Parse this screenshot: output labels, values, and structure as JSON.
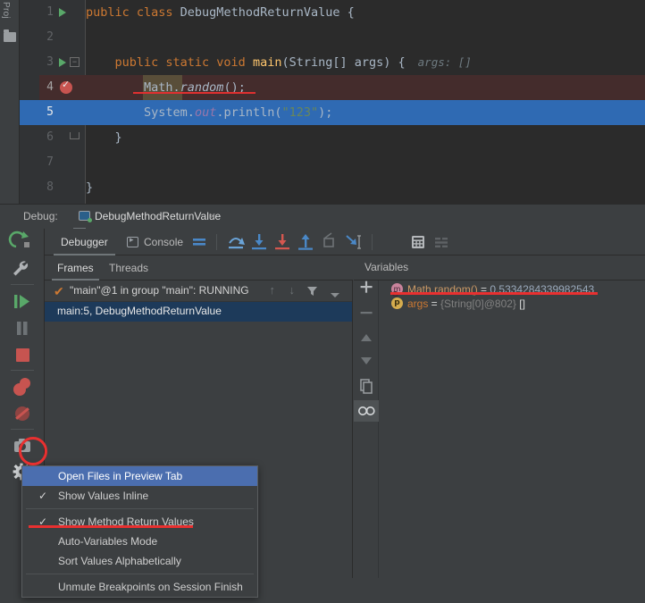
{
  "toolwindow": {
    "project_label": "Proj",
    "folder_icon": "folder-icon"
  },
  "editor": {
    "lines": [
      {
        "number": "1",
        "text": "public class DebugMethodReturnValue {"
      },
      {
        "number": "2",
        "text": ""
      },
      {
        "number": "3",
        "text": "    public static void main(String[] args) {"
      },
      {
        "number": "4",
        "text": "        Math.random();"
      },
      {
        "number": "5",
        "text": "        System.out.println(\"123\");"
      },
      {
        "number": "6",
        "text": "    }"
      },
      {
        "number": "7",
        "text": ""
      },
      {
        "number": "8",
        "text": "}"
      }
    ],
    "tokens": {
      "l1_kw": "public class ",
      "l1_cls": "DebugMethodReturnValue",
      "l1_brace": " {",
      "l3_kw1": "public static void ",
      "l3_mth": "main",
      "l3_rest": "(String[] args) {",
      "l3_hint": "args: []",
      "l4_a": "Math.",
      "l4_b": "random",
      "l4_c": "();",
      "l5_a": "System.",
      "l5_out": "out",
      "l5_b": ".println(",
      "l5_str": "\"123\"",
      "l5_c": ");",
      "l6": "}",
      "l8": "}"
    }
  },
  "debug_header": {
    "label": "Debug:",
    "tab_title": "DebugMethodReturnValue",
    "close_glyph": "×"
  },
  "side_toolbar": {
    "items": [
      {
        "name": "rerun-icon",
        "title": "Rerun"
      },
      {
        "name": "settings-wrench-icon",
        "title": "Settings"
      },
      {
        "name": "resume-program-icon",
        "title": "Resume Program"
      },
      {
        "name": "pause-program-icon",
        "title": "Pause Program"
      },
      {
        "name": "stop-icon",
        "title": "Stop"
      },
      {
        "name": "view-breakpoints-icon",
        "title": "View Breakpoints"
      },
      {
        "name": "mute-breakpoints-icon",
        "title": "Mute Breakpoints"
      },
      {
        "name": "camera-icon",
        "title": "Get Thread Dump"
      },
      {
        "name": "gear-settings-icon",
        "title": "Settings"
      }
    ]
  },
  "debug_toolbar": {
    "tab_debugger": "Debugger",
    "tab_console": "Console",
    "icons": [
      {
        "name": "show-execution-point-icon"
      },
      {
        "name": "step-over-icon"
      },
      {
        "name": "step-into-icon"
      },
      {
        "name": "force-step-into-icon"
      },
      {
        "name": "step-out-icon"
      },
      {
        "name": "drop-frame-icon"
      },
      {
        "name": "run-to-cursor-icon"
      },
      {
        "name": "evaluate-expression-icon"
      },
      {
        "name": "layout-settings-icon"
      }
    ]
  },
  "frames": {
    "tab_frames": "Frames",
    "tab_threads": "Threads",
    "thread": "\"main\"@1 in group \"main\": RUNNING",
    "thread_check": "✔",
    "stack_frame": "main:5, DebugMethodReturnValue",
    "nav_up": "↑",
    "nav_down": "↓",
    "filter_icon": "filter-icon",
    "dropdown_icon": "chevron-down-icon"
  },
  "variables": {
    "header": "Variables",
    "toolbar": [
      {
        "name": "add-watch-button",
        "glyph": "+"
      },
      {
        "name": "remove-watch-button",
        "glyph": "−"
      },
      {
        "name": "move-up-button",
        "glyph": "▲"
      },
      {
        "name": "move-down-button",
        "glyph": "▼"
      },
      {
        "name": "copy-button",
        "glyph": "copy-icon"
      },
      {
        "name": "watches-toggle",
        "glyph": "watches-icon"
      }
    ],
    "rows": [
      {
        "icon": "method-return-icon",
        "icon_letter": "m",
        "name": "Math.random()",
        "eq": " = ",
        "value": "0.5334284339982543",
        "ref": "",
        "tail": ""
      },
      {
        "icon": "parameter-icon",
        "icon_letter": "p",
        "name": "args",
        "eq": " = ",
        "value": "",
        "ref": "{String[0]@802}",
        "tail": " []"
      }
    ]
  },
  "context_menu": {
    "items": [
      {
        "label": "Open Files in Preview Tab",
        "checked": false,
        "selected": true,
        "separator_after": false
      },
      {
        "label": "Show Values Inline",
        "checked": true,
        "selected": false,
        "separator_after": true
      },
      {
        "label": "Show Method Return Values",
        "checked": true,
        "selected": false,
        "separator_after": false
      },
      {
        "label": "Auto-Variables Mode",
        "checked": false,
        "selected": false,
        "separator_after": false
      },
      {
        "label": "Sort Values Alphabetically",
        "checked": false,
        "selected": false,
        "separator_after": true
      },
      {
        "label": "Unmute Breakpoints on Session Finish",
        "checked": false,
        "selected": false,
        "separator_after": false
      }
    ],
    "check_glyph": "✓"
  },
  "annotations": {
    "accent_red": "#e83030",
    "selection_blue": "#2f6ab3",
    "menu_select_blue": "#4b6eaf"
  }
}
